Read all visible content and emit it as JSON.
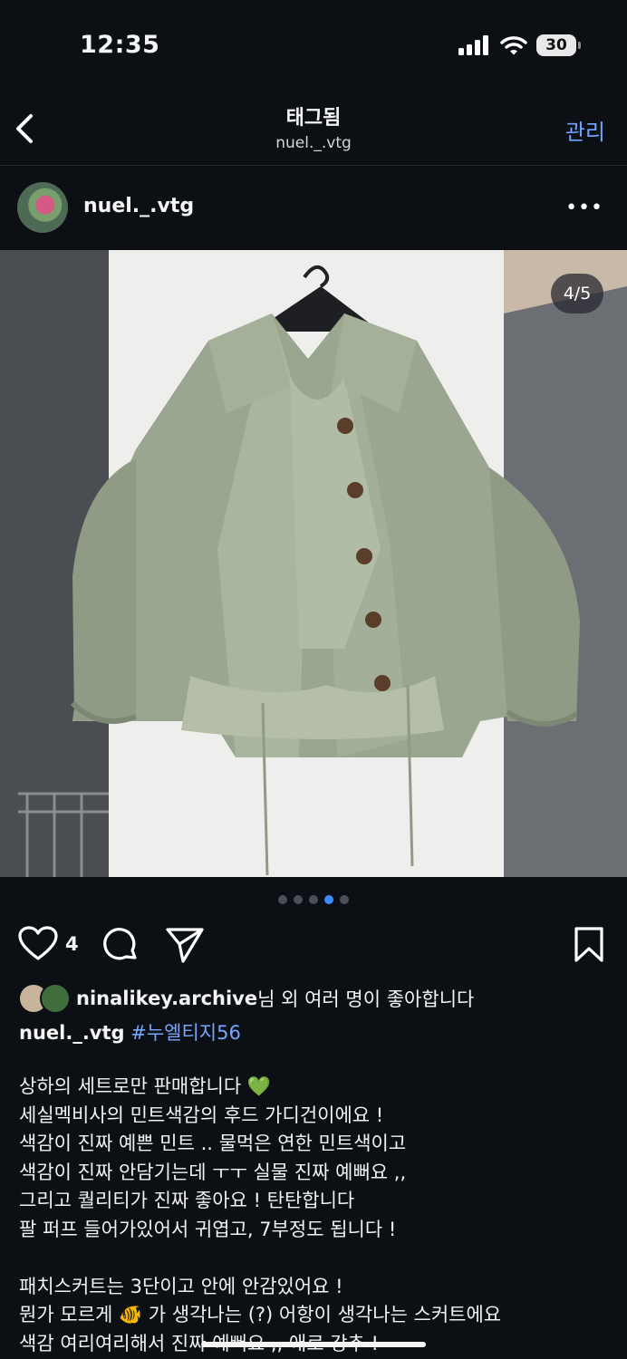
{
  "status": {
    "time": "12:35",
    "battery": "30"
  },
  "nav": {
    "title": "태그됨",
    "subtitle": "nuel._.vtg",
    "manage": "관리"
  },
  "post": {
    "username": "nuel._.vtg",
    "counter": "4/5",
    "carousel": {
      "total": 5,
      "active": 4
    },
    "likes": "4",
    "liked_by_name": "ninalikey.archive",
    "liked_by_suffix": "님 외 여러 명이 좋아합니다",
    "caption_user": "nuel._.vtg",
    "caption_tag": "#누엘티지56",
    "text_lines": [
      "상하의 세트로만 판매합니다 💚",
      "세실멕비사의 민트색감의 후드 가디건이에요 !",
      "색감이 진짜 예쁜 민트 .. 물먹은 연한 민트색이고",
      "색감이 진짜 안담기는데 ㅜㅜ 실물 진짜 예뻐요 ,,",
      "그리고 퀄리티가 진짜 좋아요 ! 탄탄합니다",
      "팔 퍼프 들어가있어서 귀엽고, 7부정도 됩니다 !",
      "",
      "패치스커트는 3단이고 안에 안감있어요 !",
      "뭔가 모르게 🐠 가 생각나는 (?) 어항이 생각나는 스커트에요",
      "색감 여리여리해서 진짜 예뻐요 ,, 애로 강추 !"
    ]
  },
  "colors": {
    "background": "#0c0f14",
    "accent": "#6ea6ff",
    "hashtag": "#76a7ff",
    "active_dot": "#3d8bfd"
  }
}
